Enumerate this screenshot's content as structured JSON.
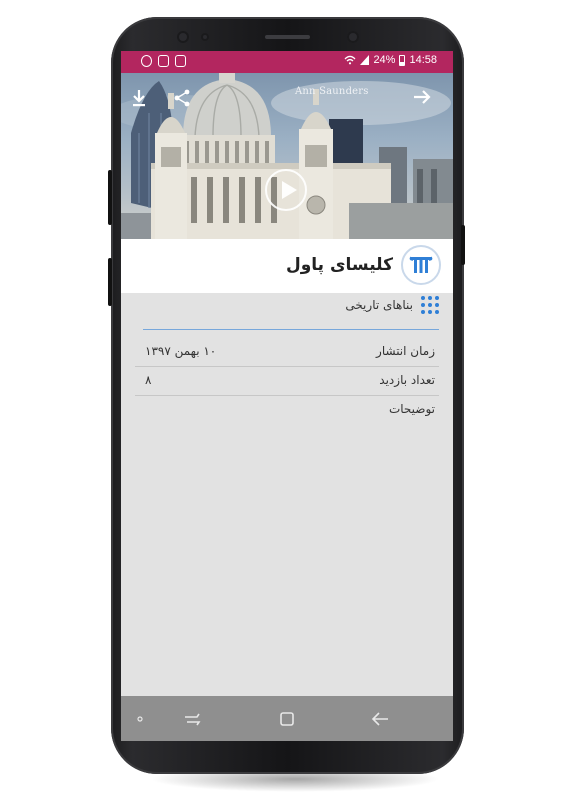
{
  "status_bar": {
    "time": "14:58",
    "battery": "24%"
  },
  "hero": {
    "caption": "Ann Saunders"
  },
  "page": {
    "title": "کلیسای پاول",
    "category": "بناهای تاریخی"
  },
  "details": [
    {
      "label": "زمان انتشار",
      "value": "۱۰ بهمن ۱۳۹۷"
    },
    {
      "label": "تعداد بازدید",
      "value": "۸"
    },
    {
      "label": "توضیحات",
      "value": ""
    }
  ],
  "colors": {
    "status_bar": "#b3265f",
    "accent": "#2f7fd6",
    "content_bg": "#e2e2e2",
    "nav_bar": "#8f8f8f"
  },
  "icons": {
    "download": "download-icon",
    "share": "share-icon",
    "back": "arrow-right-icon",
    "play": "play-icon",
    "category": "grid-dots-icon",
    "badge": "column-icon"
  }
}
